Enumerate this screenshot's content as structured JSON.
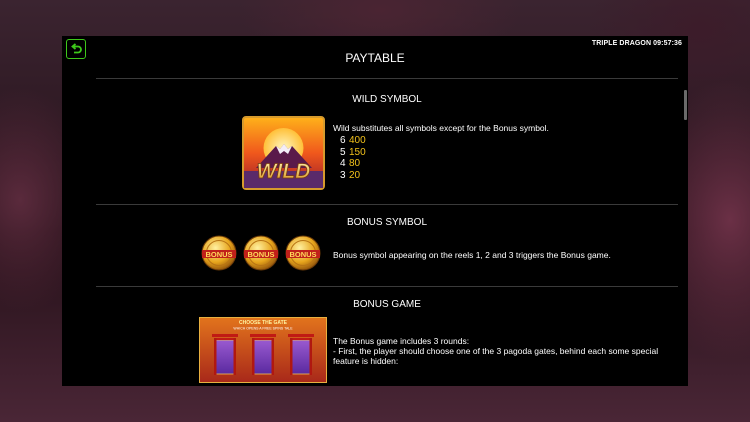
{
  "header": {
    "game_name": "TRIPLE DRAGON",
    "clock": "09:57:36",
    "title": "PAYTABLE"
  },
  "icons": {
    "back": "back-arrow-icon"
  },
  "colors": {
    "accent_green": "#3ec81a",
    "payout_gold": "#f3c21b",
    "panel": "#000000"
  },
  "wild": {
    "title": "WILD SYMBOL",
    "symbol_text": "WILD",
    "description": "Wild substitutes all symbols except for the Bonus symbol.",
    "payouts": [
      {
        "count": "6",
        "value": "400"
      },
      {
        "count": "5",
        "value": "150"
      },
      {
        "count": "4",
        "value": "80"
      },
      {
        "count": "3",
        "value": "20"
      }
    ]
  },
  "bonus_symbol": {
    "title": "BONUS SYMBOL",
    "symbol_text": "BONUS",
    "description": "Bonus symbol appearing on the reels 1, 2 and 3 triggers the Bonus game."
  },
  "bonus_game": {
    "title": "BONUS GAME",
    "image_caption": "CHOOSE THE GATE",
    "image_subcaption": "WHICH OPENS A FREE SPINS TALE",
    "description_line1": "The Bonus game includes 3 rounds:",
    "description_line2": "- First, the player should choose one of the 3 pagoda gates, behind each some special",
    "description_line3": "feature is hidden:"
  }
}
